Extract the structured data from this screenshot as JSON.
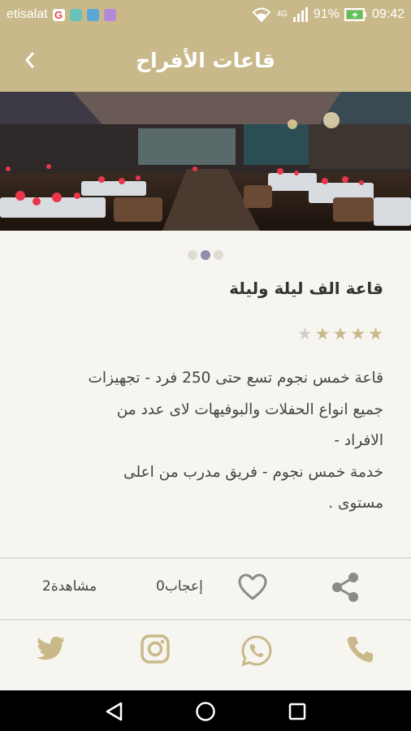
{
  "status_bar": {
    "carrier": "etisalat",
    "network": "4G",
    "battery": "91%",
    "time": "09:42"
  },
  "app_bar": {
    "title": "قاعات الأفراح"
  },
  "carousel": {
    "slide_count": 3,
    "active_index": 1
  },
  "hall": {
    "name": "قاعة الف ليلة وليلة",
    "rating": 4,
    "rating_max": 5,
    "description": "قاعة خمس نجوم تسع حتى 250 فرد - تجهيزات\nجميع انواع الحفلات والبوفيهات لاى عدد من\nالافراد -\nخدمة خمس نجوم - فريق مدرب من اعلى\nمستوى ."
  },
  "stats": {
    "likes": "0إعجاب",
    "views": "2مشاهدة"
  },
  "colors": {
    "accent": "#c9b98a",
    "star_filled": "#c9b98a",
    "star_empty": "#cfcfcf",
    "icon_gray": "#8a8a8a"
  },
  "icons": {
    "social": [
      "phone-icon",
      "whatsapp-icon",
      "instagram-icon",
      "twitter-icon"
    ],
    "stats": [
      "share-icon",
      "heart-icon"
    ],
    "nav": [
      "back-triangle-icon",
      "home-circle-icon",
      "recents-square-icon"
    ]
  }
}
